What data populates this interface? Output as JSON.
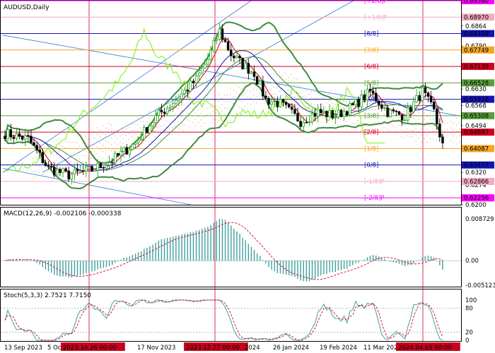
{
  "chart_data": {
    "type": "candlestick",
    "symbol_label": "AUDUSD,Daily",
    "price_axis": {
      "min": 0.62,
      "max": 0.6958,
      "ticks": [
        "0.6958",
        "0.6897",
        "0.6864",
        "0.6835",
        "0.6790",
        "0.6774",
        "0.6713",
        "0.6652",
        "0.6630",
        "0.6591",
        "0.6568",
        "0.6530",
        "0.6494",
        "0.6469",
        "0.6408",
        "0.6347",
        "0.6320",
        "0.6286",
        "0.6274",
        "0.6225",
        "0.6200"
      ],
      "highlighted": [
        {
          "value": "0.69580",
          "color": "#f0f"
        },
        {
          "value": "0.68970",
          "color": "#f4aac0"
        },
        {
          "value": "0.68359",
          "color": "#1414b4"
        },
        {
          "value": "0.67749",
          "color": "#f5a623"
        },
        {
          "value": "0.67139",
          "color": "#d0001e"
        },
        {
          "value": "0.66528",
          "color": "#5aa03c"
        },
        {
          "value": "0.65918",
          "color": "#1414b4"
        },
        {
          "value": "0.65308",
          "color": "#5aa03c"
        },
        {
          "value": "0.64697",
          "color": "#d0001e"
        },
        {
          "value": "0.64087",
          "color": "#f5a623"
        },
        {
          "value": "0.63477",
          "color": "#1414b4"
        },
        {
          "value": "0.62866",
          "color": "#f4aac0"
        },
        {
          "value": "0.62256",
          "color": "#f0f"
        }
      ]
    },
    "murrey_levels": [
      {
        "label": "[+2/8]P",
        "value": 0.6958,
        "color": "#f0f"
      },
      {
        "label": "[+1/8]P",
        "value": 0.6897,
        "color": "#f4aac0"
      },
      {
        "label": "[8/8]",
        "value": 0.68359,
        "color": "#1414b4"
      },
      {
        "label": "[7/8]",
        "value": 0.67749,
        "color": "#f5a623"
      },
      {
        "label": "[6/8]",
        "value": 0.67139,
        "color": "#d0001e"
      },
      {
        "label": "[5/8]",
        "value": 0.66528,
        "color": "#5aa03c"
      },
      {
        "label": "[4/8]",
        "value": 0.65918,
        "color": "#1414b4"
      },
      {
        "label": "[3/8]",
        "value": 0.65308,
        "color": "#5aa03c"
      },
      {
        "label": "[2/8]",
        "value": 0.64697,
        "color": "#d0001e"
      },
      {
        "label": "[1/8]",
        "value": 0.64087,
        "color": "#f5a623"
      },
      {
        "label": "[0/8]",
        "value": 0.63477,
        "color": "#1414b4"
      },
      {
        "label": "[-1/8]P",
        "value": 0.62866,
        "color": "#f4aac0"
      },
      {
        "label": "[-2/8]P",
        "value": 0.62256,
        "color": "#f0f"
      }
    ],
    "x_labels": [
      "13 Sep 2023",
      "5 Oct",
      "2023.10.26 00:00",
      "17 Nov 2023",
      "2023.12.27 00:00",
      "2024",
      "26 Jan 2024",
      "19 Feb 2024",
      "11 Mar 202",
      "2024.04.05 00:00"
    ],
    "highlighted_dates": [
      "2023.10.26 00:00",
      "2023.12.27 00:00",
      "2024.04.05 00:00"
    ],
    "macd": {
      "label": "MACD(12,26,9) -0.002106 -0.000338",
      "ticks": [
        "0.008729",
        "0.00",
        "-0.005123"
      ],
      "range": [
        -0.005123,
        0.008729
      ]
    },
    "stoch": {
      "label": "Stoch(5,3,3) 2.7521 7.7150",
      "ticks": [
        "100",
        "80",
        "20",
        "0"
      ],
      "range": [
        0,
        100
      ]
    },
    "colors": {
      "bull": "#00a000",
      "bear": "#000",
      "ma_red": "#d0001e",
      "ma_blue": "#1414b4",
      "bollinger": "#3c8c3c",
      "light_green": "#7cf000",
      "cloud": "#e0a070",
      "channel": "#2c7ad6",
      "macd_hist": "#40a0a0",
      "signal": "#d0001e"
    }
  }
}
